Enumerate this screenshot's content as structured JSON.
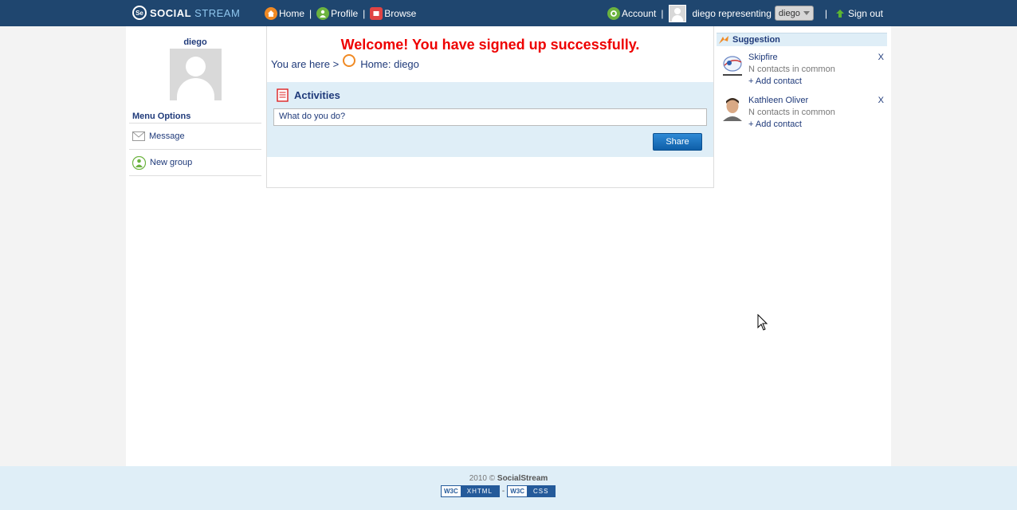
{
  "topbar": {
    "logo_prefix": "SOCIAL",
    "logo_suffix": "STREAM",
    "logo_mark": "Se",
    "nav_left": [
      {
        "label": "Home",
        "icon": "home-icon"
      },
      {
        "label": "Profile",
        "icon": "profile-icon"
      },
      {
        "label": "Browse",
        "icon": "browse-icon"
      }
    ],
    "account_label": "Account",
    "representing_text": "diego representing",
    "representing_value": "diego",
    "signout_label": "Sign out"
  },
  "sidebar": {
    "username": "diego",
    "menu_title": "Menu Options",
    "items": [
      {
        "label": "Message",
        "icon": "envelope-icon"
      },
      {
        "label": "New group",
        "icon": "group-icon"
      }
    ]
  },
  "main": {
    "welcome": "Welcome! You have signed up successfully.",
    "breadcrumb_prefix": "You are here >",
    "breadcrumb_current": "Home: diego",
    "activities_title": "Activities",
    "activity_input_value": "What do you do?",
    "share_label": "Share"
  },
  "suggestions": {
    "title": "Suggestion",
    "items": [
      {
        "name": "Skipfire",
        "common": "N contacts in common",
        "add": "+ Add contact",
        "dismiss": "X"
      },
      {
        "name": "Kathleen Oliver",
        "common": "N contacts in common",
        "add": "+ Add contact",
        "dismiss": "X"
      }
    ]
  },
  "footer": {
    "year": "2010 ©",
    "brand": "SocialStream",
    "badge_xhtml": "XHTML",
    "badge_css": "CSS",
    "badge_w3c": "W3C",
    "separator": "-"
  },
  "colors": {
    "topbar": "#1f466f",
    "accent_red": "#ee0000",
    "link_blue": "#1f3a7a",
    "panel_blue": "#dfeef7"
  }
}
